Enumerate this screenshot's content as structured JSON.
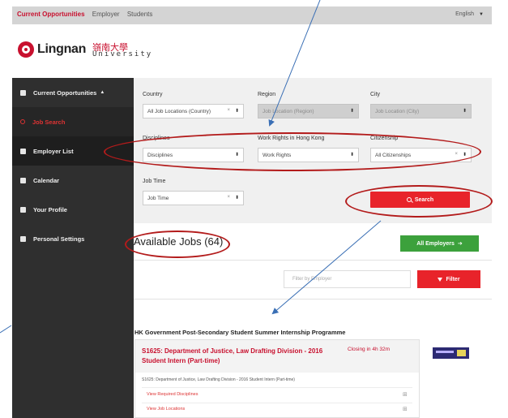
{
  "topbar": {
    "nav": [
      "Current Opportunities",
      "Employer",
      "Students"
    ],
    "language": "English"
  },
  "logo": {
    "en": "Lingnan",
    "zh": "嶺南大學",
    "uni": "University"
  },
  "sidebar": {
    "items": [
      {
        "label": "Current Opportunities",
        "icon": "document-icon",
        "expanded": true
      },
      {
        "label": "Job Search",
        "icon": "search-icon"
      },
      {
        "label": "Employer List",
        "icon": "list-icon"
      },
      {
        "label": "Calendar",
        "icon": "calendar-icon"
      },
      {
        "label": "Your Profile",
        "icon": "user-icon"
      },
      {
        "label": "Personal Settings",
        "icon": "settings-icon"
      }
    ]
  },
  "filters": {
    "country_label": "Country",
    "country_value": "All Job Locations (Country)",
    "region_label": "Region",
    "region_value": "Job Location (Region)",
    "city_label": "City",
    "city_value": "Job Location (City)",
    "disciplines_label": "Disciplines",
    "disciplines_value": "Disciplines",
    "work_rights_label": "Work Rights in Hong Kong",
    "work_rights_value": "Work Rights",
    "citizenship_label": "Citizenship",
    "citizenship_value": "All Citizenships",
    "job_time_label": "Job Time",
    "job_time_value": "Job Time",
    "search_label": "Search"
  },
  "jobs": {
    "title": "Available Jobs (64)",
    "all_employers_label": "All Employers",
    "filter_placeholder": "Filter by Employer",
    "filter_label": "Filter",
    "programme": "HK Government Post-Secondary Student Summer Internship Programme",
    "job_title": "S1625: Department of Justice, Law Drafting Division - 2016 Student Intern (Part-time)",
    "closing": "Closing in 4h 32m",
    "description": "S1625: Department of Justice, Law Drafting Division - 2016 Student Intern (Part-time)",
    "link_disciplines": "View Required Disciplines",
    "link_locations": "View Job Locations"
  },
  "colors": {
    "brand_red": "#c8102e",
    "search_red": "#e8232a",
    "employers_green": "#3ca13c",
    "sidebar_dark": "#2f2f2f",
    "annotation_red": "#b31b1b",
    "annotation_blue": "#3a6fb5"
  }
}
